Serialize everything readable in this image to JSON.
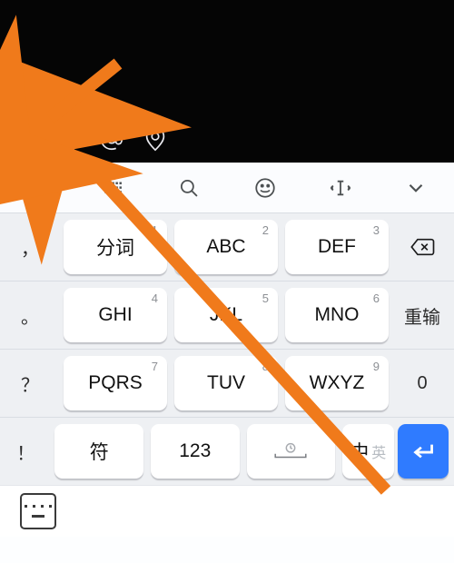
{
  "colors": {
    "accent": "#2f7bff",
    "arrow": "#f07a1b",
    "keyBg": "#ffffff",
    "trayBg": "#eef0f3"
  },
  "icon_strip": [
    "hashtag-tv-icon",
    "kaomoji-icon",
    "at-icon",
    "location-icon"
  ],
  "tool_row": [
    "grid-icon",
    "keyboard-layout-icon",
    "search-icon",
    "emoji-icon",
    "cursor-icon",
    "chevron-down-icon"
  ],
  "side_left": {
    "row1": "，",
    "row2": "。",
    "row3": "？",
    "row4": "！"
  },
  "side_right": {
    "row1": "delete",
    "row2": "重输",
    "row3": "0"
  },
  "keys": {
    "r1c1": {
      "num": "1",
      "label": "分词"
    },
    "r1c2": {
      "num": "2",
      "label": "ABC"
    },
    "r1c3": {
      "num": "3",
      "label": "DEF"
    },
    "r2c1": {
      "num": "4",
      "label": "GHI"
    },
    "r2c2": {
      "num": "5",
      "label": "JKL"
    },
    "r2c3": {
      "num": "6",
      "label": "MNO"
    },
    "r3c1": {
      "num": "7",
      "label": "PQRS"
    },
    "r3c2": {
      "num": "8",
      "label": "TUV"
    },
    "r3c3": {
      "num": "9",
      "label": "WXYZ"
    }
  },
  "bottom": {
    "symbol": "符",
    "numeric": "123",
    "space": "space",
    "lang_main": "中",
    "lang_alt": "英",
    "enter": "enter"
  }
}
